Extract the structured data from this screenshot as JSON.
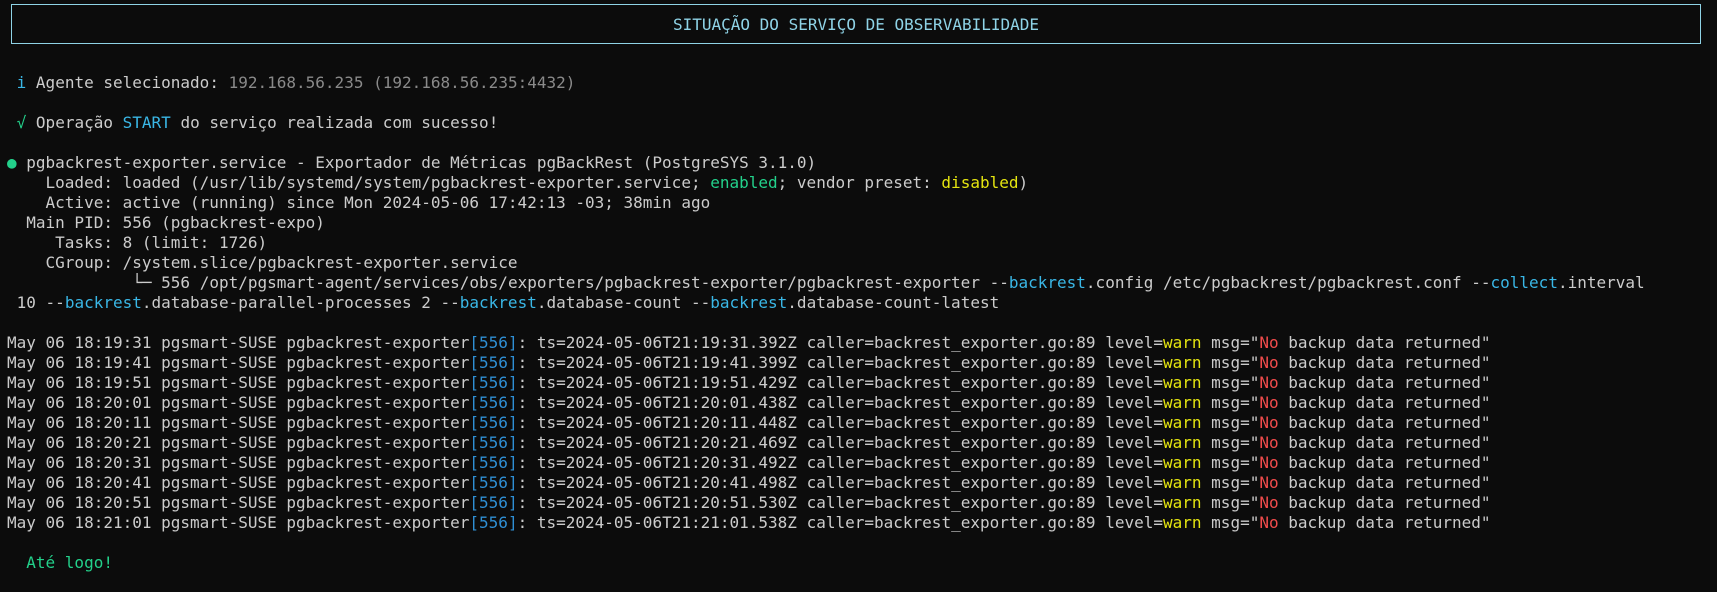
{
  "banner": {
    "title": "SITUAÇÃO DO SERVIÇO DE OBSERVABILIDADE"
  },
  "agent": {
    "info_icon": "i",
    "label": "Agente selecionado:",
    "value": "192.168.56.235 (192.168.56.235:4432)"
  },
  "operation": {
    "check_icon": "√",
    "prefix": "Operação",
    "op": "START",
    "suffix": "do serviço realizada com sucesso!"
  },
  "service": {
    "dot": "●",
    "title": "pgbackrest-exporter.service - Exportador de Métricas pgBackRest (PostgreSYS 3.1.0)",
    "loaded_key": "Loaded:",
    "loaded_pre": "loaded (/usr/lib/systemd/system/pgbackrest-exporter.service;",
    "loaded_enabled": "enabled",
    "loaded_mid": "; vendor preset:",
    "loaded_disabled": "disabled",
    "loaded_post": ")",
    "active_key": "Active:",
    "active_value": "active (running) since Mon 2024-05-06 17:42:13 -03; 38min ago",
    "pid_key": "Main PID:",
    "pid_value": "556 (pgbackrest-expo)",
    "tasks_key": "Tasks:",
    "tasks_value": "8 (limit: 1726)",
    "cgroup_key": "CGroup:",
    "cgroup_value": "/system.slice/pgbackrest-exporter.service",
    "cmd_tree": "└─",
    "cmd_pid": "556",
    "cmd_path": "/opt/pgsmart-agent/services/obs/exporters/pgbackrest-exporter/pgbackrest-exporter",
    "flag_dashes": "--",
    "flag_backrest": "backrest",
    "flag_collect": "collect",
    "arg1_rest": ".config /etc/pgbackrest/pgbackrest.conf",
    "arg2_rest": ".interval",
    "arg2_value": "10",
    "arg3_rest": ".database-parallel-processes 2",
    "arg4_rest": ".database-count",
    "arg5_rest": ".database-count-latest"
  },
  "logs": [
    {
      "date": "May 06 18:19:31",
      "host": "pgsmart-SUSE",
      "proc": "pgbackrest-exporter",
      "pid": "[556]",
      "ts": "ts=2024-05-06T21:19:31.392Z",
      "caller": "caller=backrest_exporter.go:89",
      "level_key": "level=",
      "level": "warn",
      "msg_key": "msg=\"",
      "msg_no": "No",
      "msg_rest": " backup data returned\""
    },
    {
      "date": "May 06 18:19:41",
      "host": "pgsmart-SUSE",
      "proc": "pgbackrest-exporter",
      "pid": "[556]",
      "ts": "ts=2024-05-06T21:19:41.399Z",
      "caller": "caller=backrest_exporter.go:89",
      "level_key": "level=",
      "level": "warn",
      "msg_key": "msg=\"",
      "msg_no": "No",
      "msg_rest": " backup data returned\""
    },
    {
      "date": "May 06 18:19:51",
      "host": "pgsmart-SUSE",
      "proc": "pgbackrest-exporter",
      "pid": "[556]",
      "ts": "ts=2024-05-06T21:19:51.429Z",
      "caller": "caller=backrest_exporter.go:89",
      "level_key": "level=",
      "level": "warn",
      "msg_key": "msg=\"",
      "msg_no": "No",
      "msg_rest": " backup data returned\""
    },
    {
      "date": "May 06 18:20:01",
      "host": "pgsmart-SUSE",
      "proc": "pgbackrest-exporter",
      "pid": "[556]",
      "ts": "ts=2024-05-06T21:20:01.438Z",
      "caller": "caller=backrest_exporter.go:89",
      "level_key": "level=",
      "level": "warn",
      "msg_key": "msg=\"",
      "msg_no": "No",
      "msg_rest": " backup data returned\""
    },
    {
      "date": "May 06 18:20:11",
      "host": "pgsmart-SUSE",
      "proc": "pgbackrest-exporter",
      "pid": "[556]",
      "ts": "ts=2024-05-06T21:20:11.448Z",
      "caller": "caller=backrest_exporter.go:89",
      "level_key": "level=",
      "level": "warn",
      "msg_key": "msg=\"",
      "msg_no": "No",
      "msg_rest": " backup data returned\""
    },
    {
      "date": "May 06 18:20:21",
      "host": "pgsmart-SUSE",
      "proc": "pgbackrest-exporter",
      "pid": "[556]",
      "ts": "ts=2024-05-06T21:20:21.469Z",
      "caller": "caller=backrest_exporter.go:89",
      "level_key": "level=",
      "level": "warn",
      "msg_key": "msg=\"",
      "msg_no": "No",
      "msg_rest": " backup data returned\""
    },
    {
      "date": "May 06 18:20:31",
      "host": "pgsmart-SUSE",
      "proc": "pgbackrest-exporter",
      "pid": "[556]",
      "ts": "ts=2024-05-06T21:20:31.492Z",
      "caller": "caller=backrest_exporter.go:89",
      "level_key": "level=",
      "level": "warn",
      "msg_key": "msg=\"",
      "msg_no": "No",
      "msg_rest": " backup data returned\""
    },
    {
      "date": "May 06 18:20:41",
      "host": "pgsmart-SUSE",
      "proc": "pgbackrest-exporter",
      "pid": "[556]",
      "ts": "ts=2024-05-06T21:20:41.498Z",
      "caller": "caller=backrest_exporter.go:89",
      "level_key": "level=",
      "level": "warn",
      "msg_key": "msg=\"",
      "msg_no": "No",
      "msg_rest": " backup data returned\""
    },
    {
      "date": "May 06 18:20:51",
      "host": "pgsmart-SUSE",
      "proc": "pgbackrest-exporter",
      "pid": "[556]",
      "ts": "ts=2024-05-06T21:20:51.530Z",
      "caller": "caller=backrest_exporter.go:89",
      "level_key": "level=",
      "level": "warn",
      "msg_key": "msg=\"",
      "msg_no": "No",
      "msg_rest": " backup data returned\""
    },
    {
      "date": "May 06 18:21:01",
      "host": "pgsmart-SUSE",
      "proc": "pgbackrest-exporter",
      "pid": "[556]",
      "ts": "ts=2024-05-06T21:21:01.538Z",
      "caller": "caller=backrest_exporter.go:89",
      "level_key": "level=",
      "level": "warn",
      "msg_key": "msg=\"",
      "msg_no": "No",
      "msg_rest": " backup data returned\""
    }
  ],
  "farewell": "Até logo!",
  "colors": {
    "banner": "#8fd3e6",
    "cyan": "#3ab7e6",
    "green": "#23d18b",
    "yellow": "#e5e510",
    "red": "#f14c4c",
    "pid_blue": "#2f8fd4",
    "text": "#cccccc",
    "background": "#0c0c0c"
  }
}
